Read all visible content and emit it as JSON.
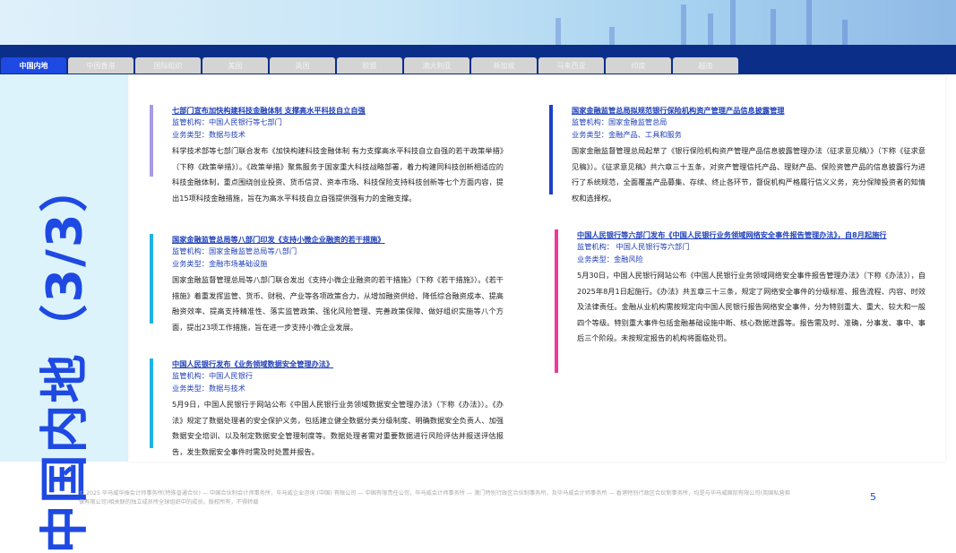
{
  "tabs": [
    "中国内地",
    "中国香港",
    "国际组织",
    "美国",
    "英国",
    "欧盟",
    "澳大利亚",
    "新加坡",
    "马来西亚",
    "印度",
    "越南"
  ],
  "active_tab": "中国内地",
  "side_title": "中国内地（3/3）",
  "items": [
    {
      "title": "七部门宣布加快构建科技金融体制 支撑高水平科技自立自强",
      "regulator": "监管机构：中国人民银行等七部门",
      "type": "业务类型：数据与技术",
      "body": "科学技术部等七部门联合发布《加快构建科技金融体制 有力支撑高水平科技自立自强的若干政策举措》（下称《政策举措》）。《政策举措》聚焦服务于国家重大科技战略部署，着力构建同科技创新相适应的科技金融体制，重点围绕创业投资、货币信贷、资本市场、科技保险支持科技创新等七个方面内容，提出15项科技金融措施，旨在为高水平科技自立自强提供强有力的金融支撑。",
      "accent": "#a99be6"
    },
    {
      "title": "国家金融监管总局等八部门印发《支持小微企业融资的若干措施》",
      "regulator": "监管机构：国家金融监管总局等八部门",
      "type": "业务类型：金融市场基础设施",
      "body": "国家金融监督管理总局等八部门联合发出《支持小微企业融资的若干措施》（下称《若干措施》）。《若干措施》着重发挥监管、货币、财税、产业等各项政策合力，从增加融资供给、降低综合融资成本、提高融资效率、提高支持精准性、落实监管政策、强化风险管理、完善政策保障、做好组织实施等八个方面，提出23项工作措施，旨在进一步支持小微企业发展。",
      "accent": "#1fb3e5"
    },
    {
      "title": "中国人民银行发布《业务领域数据安全管理办法》",
      "regulator": "监管机构：中国人民银行",
      "type": "业务类型：数据与技术",
      "body": "5月9日，中国人民银行于网站公布《中国人民银行业务领域数据安全管理办法》（下称《办法》）。《办法》规定了数据处理者的安全保护义务，包括建立健全数据分类分级制度、明确数据安全负责人、加强数据安全培训、以及制定数据安全管理制度等。数据处理者需对重要数据进行风险评估并报送评估报告，发生数据安全事件时需及时处置并报告。",
      "accent": "#1fb3e5"
    },
    {
      "title": "国家金融监管总局拟规范银行保险机构资产管理产品信息披露管理",
      "regulator": "监管机构：国家金融监管总局",
      "type": "业务类型：金融产品、工具和服务",
      "body": "国家金融监督管理总局起草了《银行保险机构资产管理产品信息披露管理办法（征求意见稿）》（下称《征求意见稿》）。《征求意见稿》共六章三十五条，对资产管理信托产品、理财产品、保险资管产品的信息披露行为进行了系统规范，全面覆盖产品募集、存续、终止各环节，督促机构严格履行信义义务，充分保障投资者的知情权和选择权。",
      "accent": "#1e40c8"
    },
    {
      "title": "中国人民银行等六部门发布《中国人民银行业务领域网络安全事件报告管理办法》，自8月起施行",
      "regulator": "监管机构： 中国人民银行等六部门",
      "type": "业务类型：金融风险",
      "body": "5月30日，中国人民银行网站公布《中国人民银行业务领域网络安全事件报告管理办法》（下称《办法》），自2025年8月1日起施行。《办法》共五章三十三条，规定了网络安全事件的分级标准、报告流程、内容、时效及法律责任。金融从业机构需按规定向中国人民银行报告网络安全事件，分为特别重大、重大、较大和一般四个等级。特别重大事件包括金融基础设施中断、核心数据泄露等。报告需及时、准确，分事发、事中、事后三个阶段。未按规定报告的机构将面临处罚。",
      "accent": "#f0389b"
    }
  ],
  "footer": "© 2025 毕马威华振会计师事务所(特殊普通合伙) — 中国合伙制会计师事务所，毕马威企业咨询 (中国) 有限公司 — 中国有限责任公司，毕马威会计师事务所 — 澳门特别行政区合伙制事务所，及毕马威会计师事务所 — 香港特别行政区合伙制事务所，均是与毕马威国际有限公司(英国私营担保有限公司)相关联的独立成员所全球组织中的成员。版权所有，不得转载",
  "page_number": "5"
}
